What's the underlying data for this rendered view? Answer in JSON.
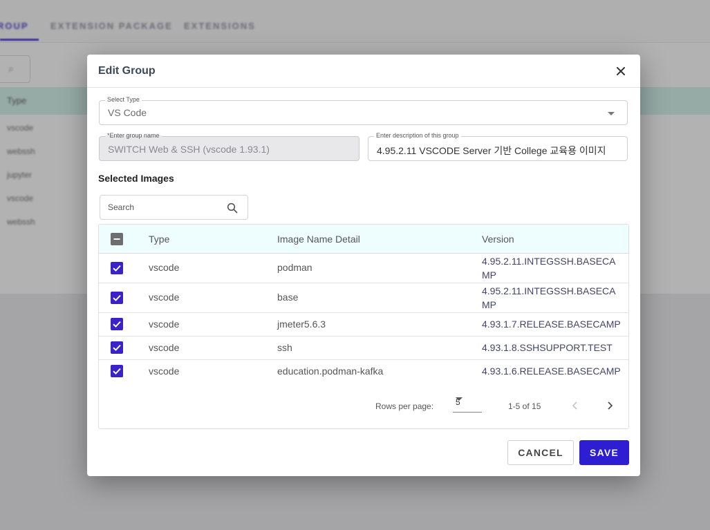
{
  "background": {
    "tabs": [
      "ROUP",
      "EXTENSION PACKAGE",
      "EXTENSIONS"
    ],
    "table_header": "Type",
    "rows": [
      "vscode",
      "webssh",
      "jupyter",
      "vscode",
      "webssh"
    ]
  },
  "dialog": {
    "title": "Edit Group",
    "select_type": {
      "label": "Select Type",
      "value": "VS Code"
    },
    "group_name": {
      "label": "*Enter group name",
      "value": "SWITCH Web & SSH (vscode 1.93.1)"
    },
    "group_desc": {
      "label": "Enter description of this group",
      "value": "4.95.2.11 VSCODE Server 기반 College 교육용 이미지"
    },
    "section_title": "Selected Images",
    "search": {
      "placeholder": "Search"
    },
    "table": {
      "headers": {
        "type": "Type",
        "name": "Image Name Detail",
        "version": "Version"
      },
      "rows": [
        {
          "type": "vscode",
          "name": "podman",
          "version": "4.95.2.11.INTEGSSH.BASECAMP",
          "checked": true
        },
        {
          "type": "vscode",
          "name": "base",
          "version": "4.95.2.11.INTEGSSH.BASECAMP",
          "checked": true
        },
        {
          "type": "vscode",
          "name": "jmeter5.6.3",
          "version": "4.93.1.7.RELEASE.BASECAMP",
          "checked": true
        },
        {
          "type": "vscode",
          "name": "ssh",
          "version": "4.93.1.8.SSHSUPPORT.TEST",
          "checked": true
        },
        {
          "type": "vscode",
          "name": "education.podman-kafka",
          "version": "4.93.1.6.RELEASE.BASECAMP",
          "checked": true
        }
      ]
    },
    "pagination": {
      "rows_per_page_label": "Rows per page:",
      "rows_per_page": "5",
      "range": "1-5 of 15"
    },
    "buttons": {
      "cancel": "CANCEL",
      "save": "SAVE"
    }
  },
  "colors": {
    "primary": "#2d1fd1",
    "checkbox": "#3b22c8",
    "header_bg": "#eefdfd"
  },
  "icons": [
    "close-icon",
    "search-icon",
    "chevron-left-icon",
    "chevron-right-icon",
    "dropdown-caret-icon",
    "check-icon"
  ]
}
